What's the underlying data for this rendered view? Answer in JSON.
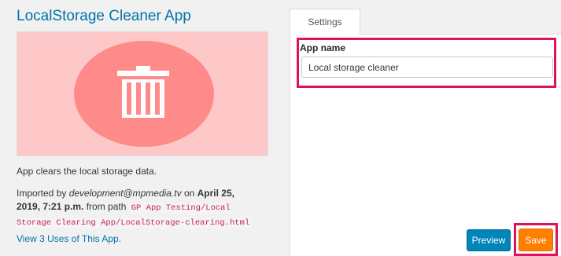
{
  "app": {
    "title": "LocalStorage Cleaner App",
    "description": "App clears the local storage data.",
    "imported_prefix": "Imported by ",
    "imported_user": "development@mpmedia.tv",
    "imported_on": " on ",
    "imported_date": "April 25, 2019, 7:21 p.m.",
    "imported_path_prefix": " from path ",
    "imported_path": "GP App Testing/Local Storage Clearing App/LocalStorage-clearing.html",
    "view_uses_link": "View 3 Uses of This App."
  },
  "thumbnail": {
    "icon": "trash-icon",
    "background_color": "#ffc8c8",
    "circle_color": "#ff8a8a"
  },
  "settings": {
    "tab_label": "Settings",
    "field_label": "App name",
    "field_value": "Local storage cleaner"
  },
  "buttons": {
    "preview": "Preview",
    "save": "Save"
  },
  "colors": {
    "accent": "#0073aa",
    "highlight": "#e0105c",
    "save": "#ff7f00",
    "preview": "#0085ba"
  }
}
